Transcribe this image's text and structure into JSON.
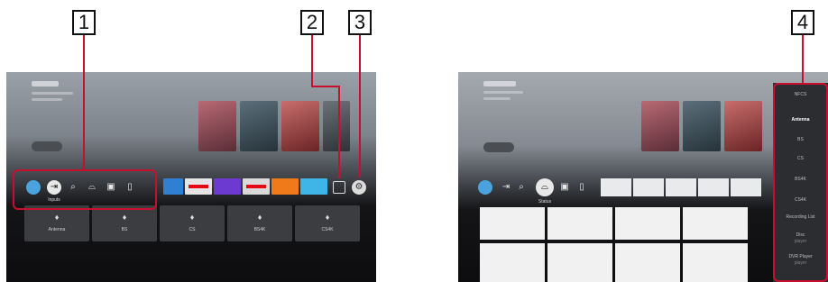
{
  "callouts": [
    "1",
    "2",
    "3",
    "4"
  ],
  "left_screen": {
    "launcher": {
      "items": [
        {
          "icon": "profile-avatar",
          "label": ""
        },
        {
          "icon": "inputs-icon",
          "label": "Inputs"
        },
        {
          "icon": "search-icon",
          "label": ""
        },
        {
          "icon": "cast-icon",
          "label": ""
        },
        {
          "icon": "store-icon",
          "label": ""
        },
        {
          "icon": "bookmark-icon",
          "label": ""
        }
      ],
      "apps_icon": "apps-grid-icon",
      "settings_icon": "gear-icon"
    },
    "input_tiles": [
      {
        "icon": "hdmi-icon",
        "label": "Antenna"
      },
      {
        "icon": "hdmi-icon",
        "label": "BS"
      },
      {
        "icon": "hdmi-icon",
        "label": "CS"
      },
      {
        "icon": "hdmi-icon",
        "label": "BS4K"
      },
      {
        "icon": "hdmi-icon",
        "label": "CS4K"
      }
    ]
  },
  "right_screen": {
    "launcher": {
      "selected_label": "Status"
    },
    "side_menu": {
      "items": [
        "NFCS",
        "Antenna",
        "BS",
        "CS",
        "BS4K",
        "CS4K",
        "Recording List",
        "Disc",
        "player",
        "DVR Player",
        "player"
      ],
      "selected_index": 1
    }
  },
  "colors": {
    "callout_line": "#c8102e",
    "highlight": "#c8102e",
    "avatar": "#4aa3df"
  }
}
